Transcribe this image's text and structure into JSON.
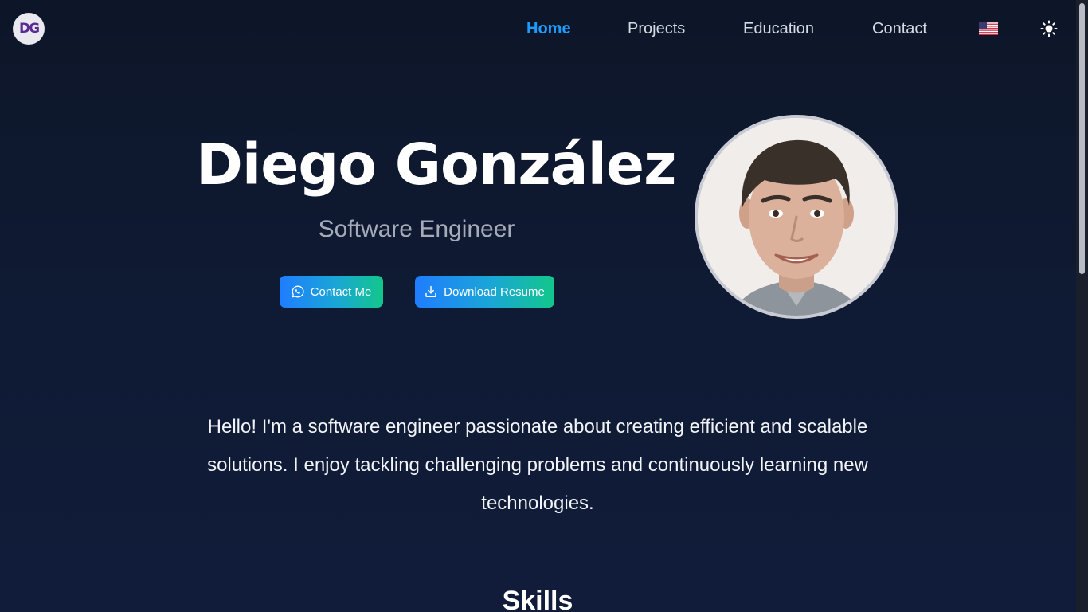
{
  "logo": {
    "text": "DG"
  },
  "nav": {
    "items": [
      {
        "label": "Home",
        "active": true
      },
      {
        "label": "Projects"
      },
      {
        "label": "Education"
      },
      {
        "label": "Contact"
      }
    ],
    "language_icon": "us-flag-icon",
    "theme_icon": "sun-icon"
  },
  "hero": {
    "name": "Diego González",
    "role": "Software Engineer",
    "contact_button": "Contact Me",
    "resume_button": "Download Resume"
  },
  "about": {
    "text": "Hello! I'm a software engineer passionate about creating efficient and scalable solutions. I enjoy tackling challenging problems and continuously learning new technologies."
  },
  "skills": {
    "title": "Skills"
  },
  "colors": {
    "background": "#0f1a33",
    "accent": "#1e9bff",
    "button_gradient_start": "#1f7dff",
    "button_gradient_end": "#12c78a"
  }
}
